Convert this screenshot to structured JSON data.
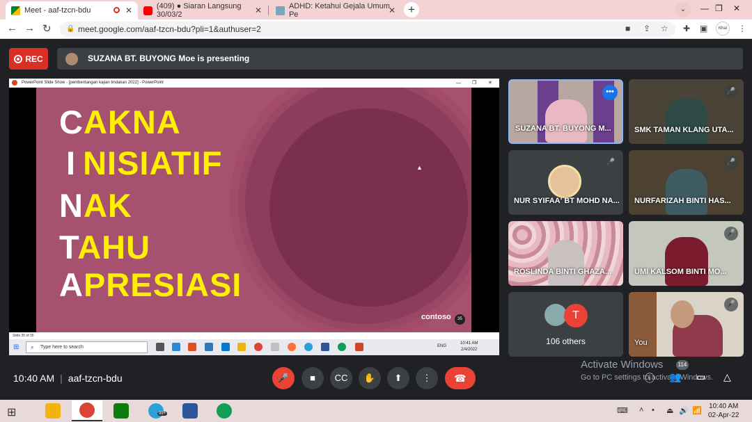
{
  "browser": {
    "tabs": [
      {
        "label": "Meet - aaf-tzcn-bdu",
        "active": true
      },
      {
        "label": "(409) ● Siaran Langsung 30/03/2",
        "active": false
      },
      {
        "label": "ADHD: Ketahui Gejala Umum Pe",
        "active": false
      }
    ],
    "url": "meet.google.com/aaf-tzcn-bdu?pli=1&authuser=2",
    "profile_label": "Khai"
  },
  "meet": {
    "rec_label": "REC",
    "presenting_text": "SUZANA BT. BUYONG Moe is presenting",
    "ppt_title": "PowerPoint Slide Show - [pembentangan kajian tindakan 2022] - PowerPoint",
    "slide": {
      "lines": [
        {
          "initial": "C",
          "rest": "AKNA"
        },
        {
          "initial": "I",
          "rest": "NISIATIF"
        },
        {
          "initial": "N",
          "rest": "AK"
        },
        {
          "initial": "T",
          "rest": "AHU"
        },
        {
          "initial": "A",
          "rest": "PRESIASI"
        }
      ],
      "brand": "contoso",
      "number": "35",
      "status": "Slide 35 of 35"
    },
    "inner_taskbar": {
      "search_placeholder": "Type here to search",
      "time": "10:41 AM",
      "date": "2/4/2022",
      "lang": "ENG"
    },
    "participants": [
      {
        "name": "SUZANA BT. BUYONG M...",
        "active": true
      },
      {
        "name": "SMK TAMAN KLANG UTA..."
      },
      {
        "name": "NUR SYIFAA' BT MOHD NA..."
      },
      {
        "name": "NURFARIZAH BINTI HAS..."
      },
      {
        "name": "ROSLINDA BINTI GHAZA..."
      },
      {
        "name": "UMI KALSOM BINTI MO..."
      },
      {
        "name": "106 others",
        "avatar_letter": "T"
      },
      {
        "name": "You"
      }
    ],
    "meeting_time": "10:40 AM",
    "meeting_code": "aaf-tzcn-bdu",
    "people_count": "114",
    "activate_title": "Activate Windows",
    "activate_sub": "Go to PC settings to activate Windows."
  },
  "taskbar": {
    "time": "10:40 AM",
    "date": "02-Apr-22",
    "telegram_badge": "99+"
  },
  "colors": {
    "rec": "#d93025",
    "end_call": "#ea4335",
    "slide_bg": "#a65170",
    "slide_text": "#ffef00"
  }
}
